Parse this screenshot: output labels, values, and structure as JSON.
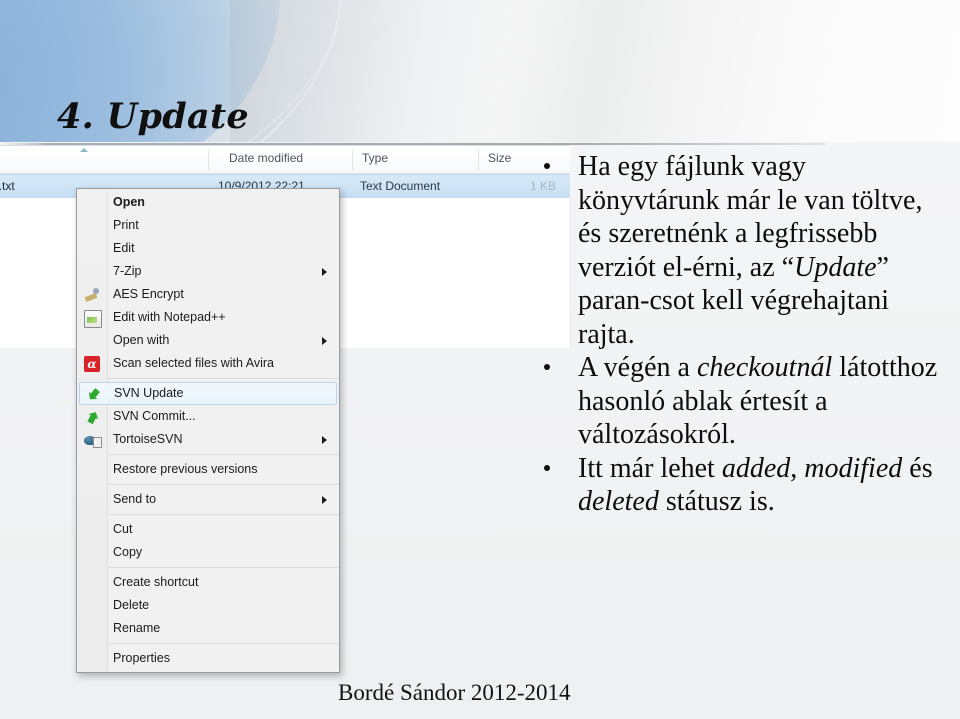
{
  "slide": {
    "title": "4. Update",
    "footer": "Bordé Sándor 2012-2014",
    "accent_blue": "#9dbfe0",
    "background": "#f2f3f5"
  },
  "explorer": {
    "columns": [
      {
        "label": "Date modified"
      },
      {
        "label": "Type"
      },
      {
        "label": "Size"
      }
    ],
    "file_row": {
      "name": "a.txt",
      "date_modified": "10/9/2012 22:21",
      "type": "Text Document",
      "size": "1 KB"
    }
  },
  "context_menu": {
    "items": [
      {
        "label": "Open",
        "bold": true,
        "icon": "none",
        "submenu": false,
        "selected": false
      },
      {
        "label": "Print",
        "bold": false,
        "icon": "none",
        "submenu": false,
        "selected": false
      },
      {
        "label": "Edit",
        "bold": false,
        "icon": "none",
        "submenu": false,
        "selected": false
      },
      {
        "label": "7-Zip",
        "bold": false,
        "icon": "none",
        "submenu": true,
        "selected": false
      },
      {
        "label": "AES Encrypt",
        "bold": false,
        "icon": "aes-encrypt-icon",
        "submenu": false,
        "selected": false
      },
      {
        "label": "Edit with Notepad++",
        "bold": false,
        "icon": "notepad-plus-plus-icon",
        "submenu": false,
        "selected": false
      },
      {
        "label": "Open with",
        "bold": false,
        "icon": "none",
        "submenu": true,
        "selected": false
      },
      {
        "label": "Scan selected files with Avira",
        "bold": false,
        "icon": "avira-icon",
        "submenu": false,
        "selected": false
      },
      {
        "label": "SVN Update",
        "bold": false,
        "icon": "svn-update-arrow-icon",
        "submenu": false,
        "selected": true
      },
      {
        "label": "SVN Commit...",
        "bold": false,
        "icon": "svn-commit-arrow-icon",
        "submenu": false,
        "selected": false
      },
      {
        "label": "TortoiseSVN",
        "bold": false,
        "icon": "tortoise-turtle-icon",
        "submenu": true,
        "selected": false
      },
      {
        "label": "Restore previous versions",
        "bold": false,
        "icon": "none",
        "submenu": false,
        "selected": false
      },
      {
        "label": "Send to",
        "bold": false,
        "icon": "none",
        "submenu": true,
        "selected": false
      },
      {
        "label": "Cut",
        "bold": false,
        "icon": "none",
        "submenu": false,
        "selected": false
      },
      {
        "label": "Copy",
        "bold": false,
        "icon": "none",
        "submenu": false,
        "selected": false
      },
      {
        "label": "Create shortcut",
        "bold": false,
        "icon": "none",
        "submenu": false,
        "selected": false
      },
      {
        "label": "Delete",
        "bold": false,
        "icon": "none",
        "submenu": false,
        "selected": false
      },
      {
        "label": "Rename",
        "bold": false,
        "icon": "none",
        "submenu": false,
        "selected": false
      },
      {
        "label": "Properties",
        "bold": false,
        "icon": "none",
        "submenu": false,
        "selected": false
      }
    ],
    "separator_after_indices": [
      7,
      10,
      11,
      12,
      14,
      17
    ],
    "highlight_color": "#e9f4fc"
  },
  "content": {
    "bullets": [
      "Ha egy fájlunk vagy könyvtárunk már le van töltve, és szeretnénk a legfrissebb verziót elérni, az “Update” parancsot kell végrehajtani rajta.",
      "A végén a checkoutnál látotthoz hasonló ablak értesít a változásokról.",
      "Itt már lehet added, modified és deleted státusz is."
    ],
    "bullets_html": [
      "Ha egy fájlunk vagy könyvtárunk már le van töltve, és szeretnénk a legfrissebb verziót el-érni, az “<i>Update</i>” paran-csot kell végrehajtani rajta.",
      "A végén a <i>checkoutnál</i> látotthoz hasonló ablak értesít a változásokról.",
      "Itt már lehet <i>added</i>, <i>modified</i> és <i>deleted</i> státusz is."
    ]
  }
}
